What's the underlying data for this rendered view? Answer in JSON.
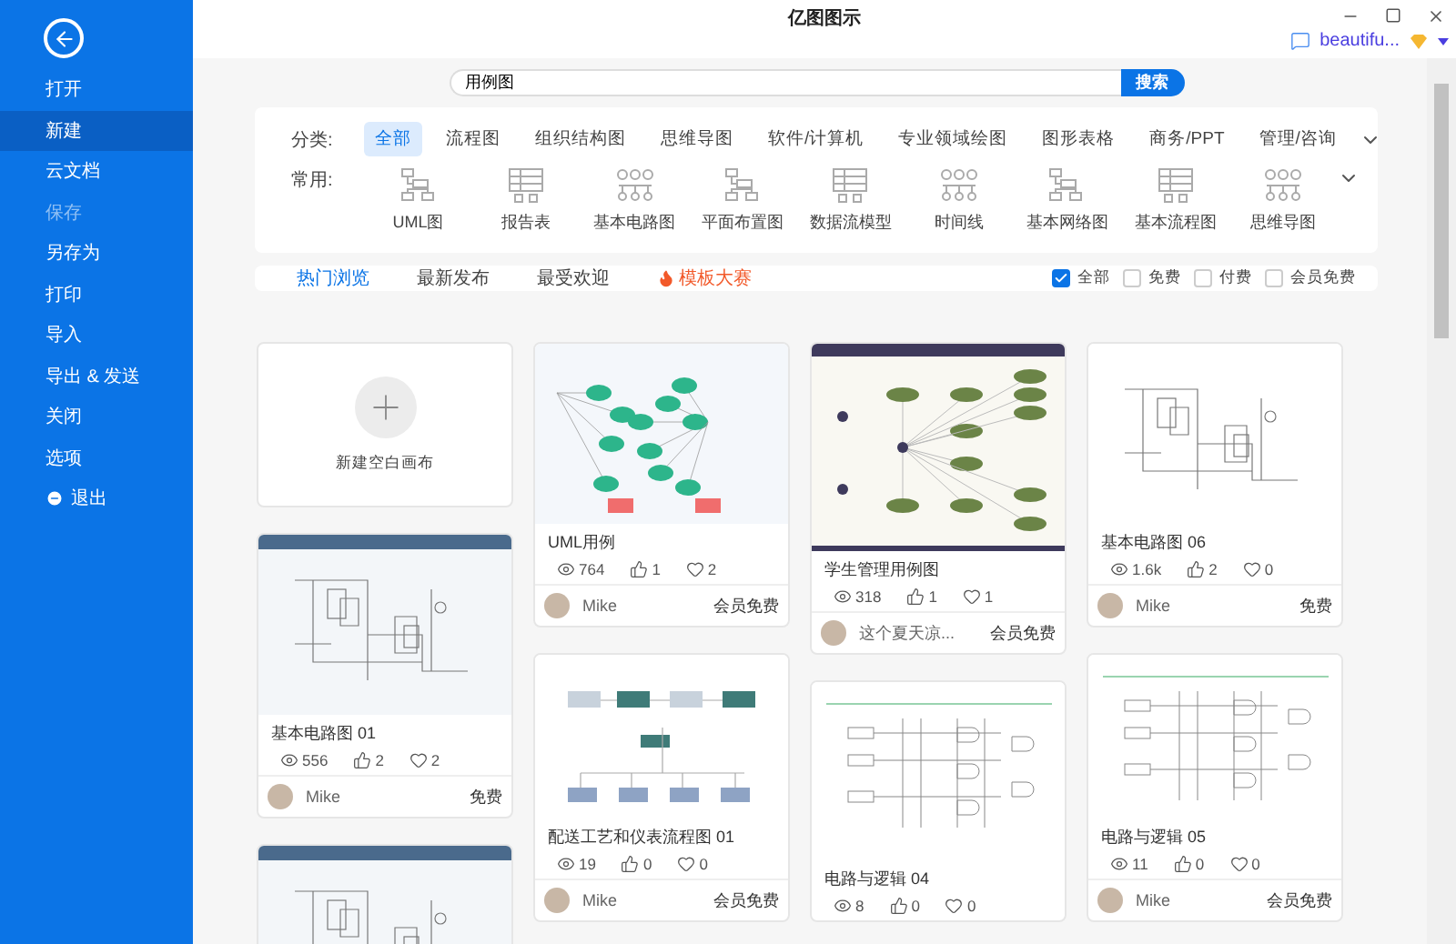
{
  "window": {
    "title": "亿图图示"
  },
  "user": {
    "name": "beautifu..."
  },
  "sidebar": {
    "items": [
      {
        "label": "打开",
        "selected": false,
        "disabled": false,
        "kind": "plain"
      },
      {
        "label": "新建",
        "selected": true,
        "disabled": false,
        "kind": "plain"
      },
      {
        "label": "云文档",
        "selected": false,
        "disabled": false,
        "kind": "plain"
      },
      {
        "label": "保存",
        "selected": false,
        "disabled": true,
        "kind": "plain"
      },
      {
        "label": "另存为",
        "selected": false,
        "disabled": false,
        "kind": "plain"
      },
      {
        "label": "打印",
        "selected": false,
        "disabled": false,
        "kind": "plain"
      },
      {
        "label": "导入",
        "selected": false,
        "disabled": false,
        "kind": "plain"
      },
      {
        "label": "导出 & 发送",
        "selected": false,
        "disabled": false,
        "kind": "plain"
      },
      {
        "label": "关闭",
        "selected": false,
        "disabled": false,
        "kind": "plain"
      },
      {
        "label": "选项",
        "selected": false,
        "disabled": false,
        "kind": "plain"
      },
      {
        "label": "退出",
        "selected": false,
        "disabled": false,
        "kind": "exit"
      }
    ]
  },
  "search": {
    "value": "用例图",
    "button": "搜索"
  },
  "categories": {
    "label": "分类:",
    "items": [
      {
        "label": "全部",
        "selected": true
      },
      {
        "label": "流程图",
        "selected": false
      },
      {
        "label": "组织结构图",
        "selected": false
      },
      {
        "label": "思维导图",
        "selected": false
      },
      {
        "label": "软件/计算机",
        "selected": false
      },
      {
        "label": "专业领域绘图",
        "selected": false
      },
      {
        "label": "图形表格",
        "selected": false
      },
      {
        "label": "商务/PPT",
        "selected": false
      },
      {
        "label": "管理/咨询",
        "selected": false
      }
    ]
  },
  "common": {
    "label": "常用:",
    "items": [
      "UML图",
      "报告表",
      "基本电路图",
      "平面布置图",
      "数据流模型",
      "时间线",
      "基本网络图",
      "基本流程图",
      "思维导图"
    ]
  },
  "sort_tabs": [
    {
      "label": "热门浏览",
      "selected": true,
      "kind": "plain"
    },
    {
      "label": "最新发布",
      "selected": false,
      "kind": "plain"
    },
    {
      "label": "最受欢迎",
      "selected": false,
      "kind": "plain"
    },
    {
      "label": "模板大赛",
      "selected": false,
      "kind": "contest"
    }
  ],
  "price_filters": [
    {
      "label": "全部",
      "checked": true
    },
    {
      "label": "免费",
      "checked": false
    },
    {
      "label": "付费",
      "checked": false
    },
    {
      "label": "会员免费",
      "checked": false
    }
  ],
  "columns": [
    [
      {
        "kind": "new",
        "title": "新建空白画布"
      },
      {
        "kind": "circuit",
        "title": "基本电路图 01",
        "views": "556",
        "likes": "2",
        "favorites": "2",
        "author": "Mike",
        "price": "免费"
      },
      {
        "kind": "circuit"
      }
    ],
    [
      {
        "kind": "mindmap",
        "title": "UML用例",
        "views": "764",
        "likes": "1",
        "favorites": "2",
        "author": "Mike",
        "price": "会员免费"
      },
      {
        "kind": "process",
        "title": "配送工艺和仪表流程图 01",
        "views": "19",
        "likes": "0",
        "favorites": "0",
        "author": "Mike",
        "price": "会员免费"
      }
    ],
    [
      {
        "kind": "usecase",
        "title": "学生管理用例图",
        "views": "318",
        "likes": "1",
        "favorites": "1",
        "author": "这个夏天凉...",
        "price": "会员免费"
      },
      {
        "kind": "logic",
        "title": "电路与逻辑 04",
        "views": "8",
        "likes": "0",
        "favorites": "0"
      }
    ],
    [
      {
        "kind": "circuit",
        "title": "基本电路图 06",
        "views": "1.6k",
        "likes": "2",
        "favorites": "0",
        "author": "Mike",
        "price": "免费"
      },
      {
        "kind": "logic",
        "title": "电路与逻辑 05",
        "views": "11",
        "likes": "0",
        "favorites": "0",
        "author": "Mike",
        "price": "会员免费"
      }
    ]
  ]
}
